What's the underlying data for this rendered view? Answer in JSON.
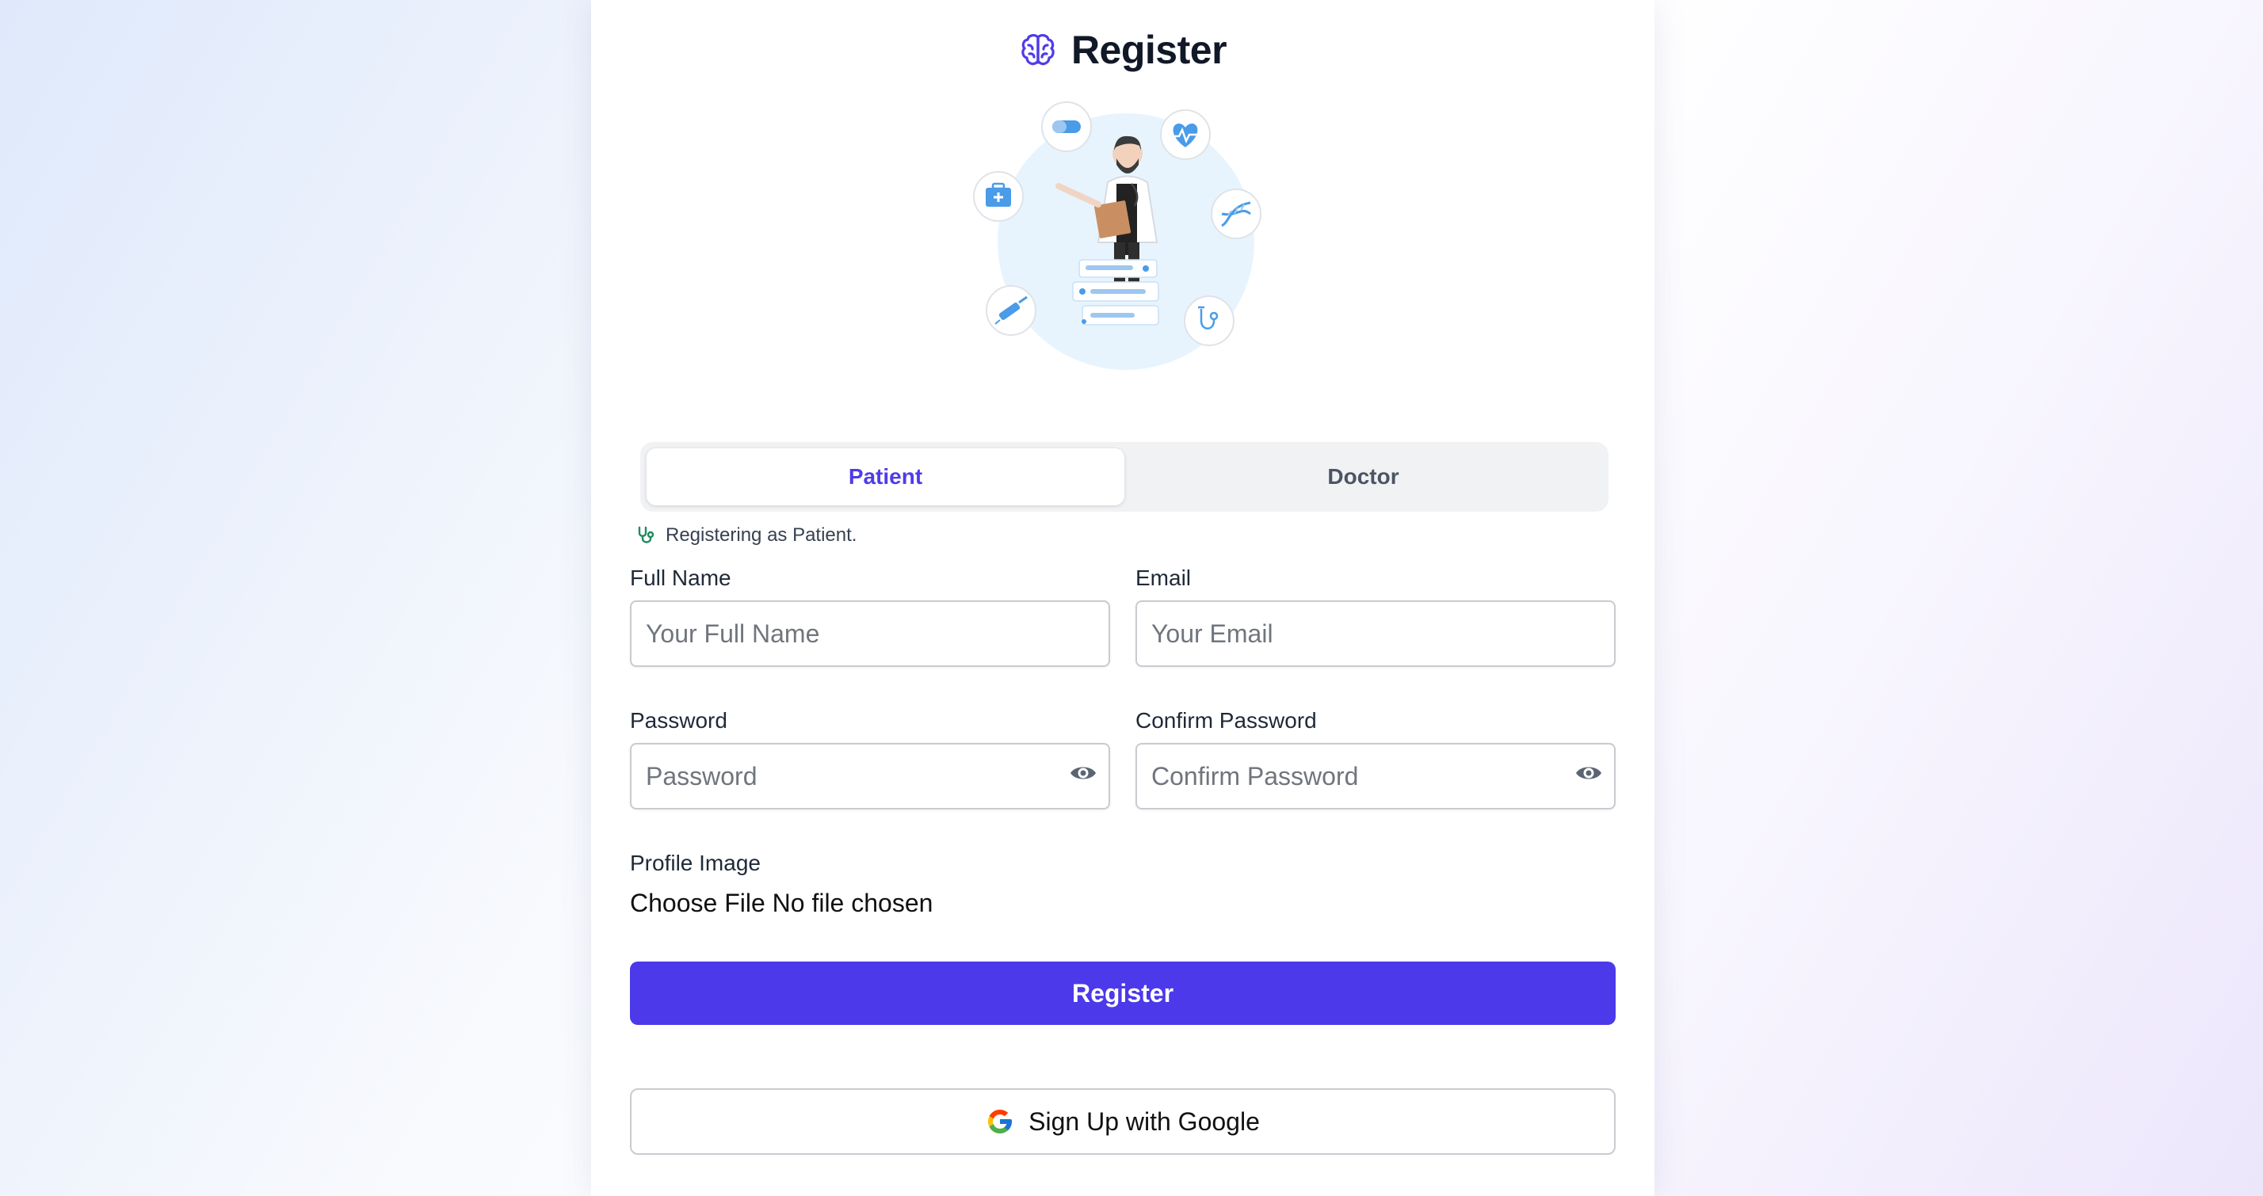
{
  "header": {
    "title": "Register",
    "icon": "brain-icon",
    "icon_color": "#4f3ce8"
  },
  "illustration": {
    "subject": "doctor-with-clipboard",
    "bg_color": "#e8f4fd",
    "icon_color": "#4a9be8"
  },
  "role_tabs": [
    {
      "label": "Patient",
      "active": true
    },
    {
      "label": "Doctor",
      "active": false
    }
  ],
  "role_note": {
    "icon": "stethoscope-icon",
    "text": "Registering as Patient."
  },
  "form": {
    "full_name": {
      "label": "Full Name",
      "placeholder": "Your Full Name",
      "value": ""
    },
    "email": {
      "label": "Email",
      "placeholder": "Your Email",
      "value": ""
    },
    "password": {
      "label": "Password",
      "placeholder": "Password",
      "value": "",
      "toggle_icon": "eye-icon"
    },
    "confirm_password": {
      "label": "Confirm Password",
      "placeholder": "Confirm Password",
      "value": "",
      "toggle_icon": "eye-icon"
    },
    "profile_image": {
      "label": "Profile Image",
      "button_text": "Choose File",
      "status": "No file chosen"
    }
  },
  "buttons": {
    "register": "Register",
    "google": "Sign Up with Google"
  },
  "colors": {
    "primary": "#4b39ea",
    "active_tab_text": "#4f3ce8",
    "note_icon": "#1f8a5b"
  }
}
